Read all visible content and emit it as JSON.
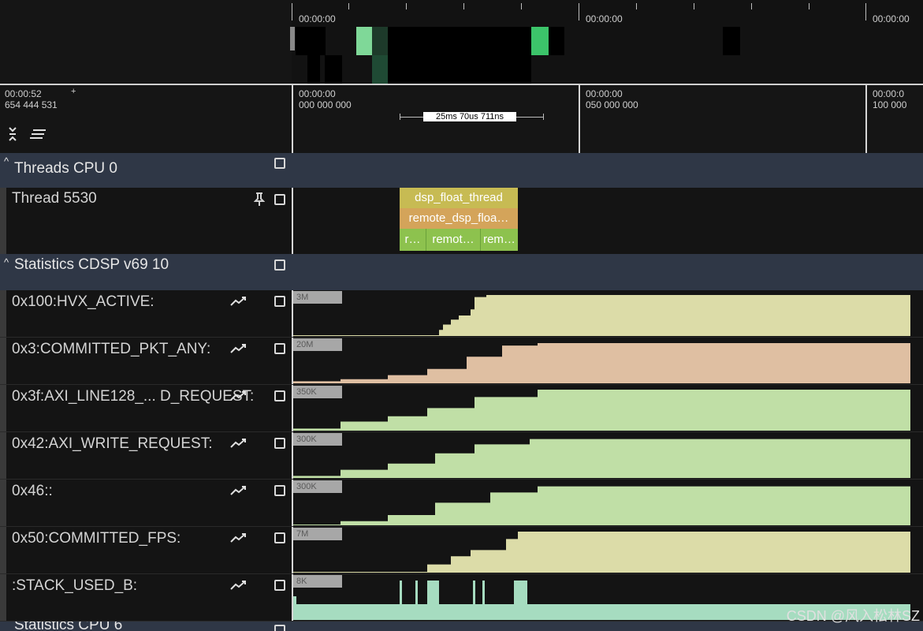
{
  "overview": {
    "time_labels": [
      "00:00:00",
      "00:00:00",
      "00:00:00"
    ]
  },
  "ruler": {
    "cursor_time": "00:00:52",
    "cursor_ns": "654 444 531",
    "ticks": [
      {
        "time": "00:00:00",
        "ns": "000 000 000"
      },
      {
        "time": "00:00:00",
        "ns": "050 000 000"
      },
      {
        "time": "00:00:0",
        "ns": "100 000"
      }
    ],
    "zoom_label": "25ms 70us 711ns"
  },
  "groups": [
    {
      "title": "Threads CPU 0"
    },
    {
      "title": "Statistics CDSP v69 10"
    },
    {
      "title": "Statistics CPU 6"
    }
  ],
  "thread": {
    "label": "Thread 5530",
    "slices": {
      "level0": "dsp_float_thread",
      "level1": "remote_dsp_floa…",
      "level2": [
        "r…",
        "remot…",
        "rem…"
      ]
    }
  },
  "counters": [
    {
      "label": "0x100:HVX_ACTIVE:",
      "max": "3M",
      "color": "#dcdca8"
    },
    {
      "label": "0x3:COMMITTED_PKT_ANY:",
      "max": "20M",
      "color": "#dfbfa2"
    },
    {
      "label": "0x3f:AXI_LINE128_... D_REQUEST:",
      "max": "350K",
      "color": "#c0dfa6"
    },
    {
      "label": "0x42:AXI_WRITE_REQUEST:",
      "max": "300K",
      "color": "#c0dfa6"
    },
    {
      "label": "0x46::",
      "max": "300K",
      "color": "#c0dfa6"
    },
    {
      "label": "0x50:COMMITTED_FPS:",
      "max": "7M",
      "color": "#dcdca8"
    },
    {
      "label": ":STACK_USED_B:",
      "max": "8K",
      "color": "#a6dcc0"
    }
  ],
  "icons": {
    "expand": "expand-collapse-icon",
    "menu": "list-menu-icon",
    "pin": "pin-icon",
    "chart": "line-chart-icon",
    "checkbox": "checkbox-icon"
  },
  "watermark": "CSDN @风入松林SZ"
}
